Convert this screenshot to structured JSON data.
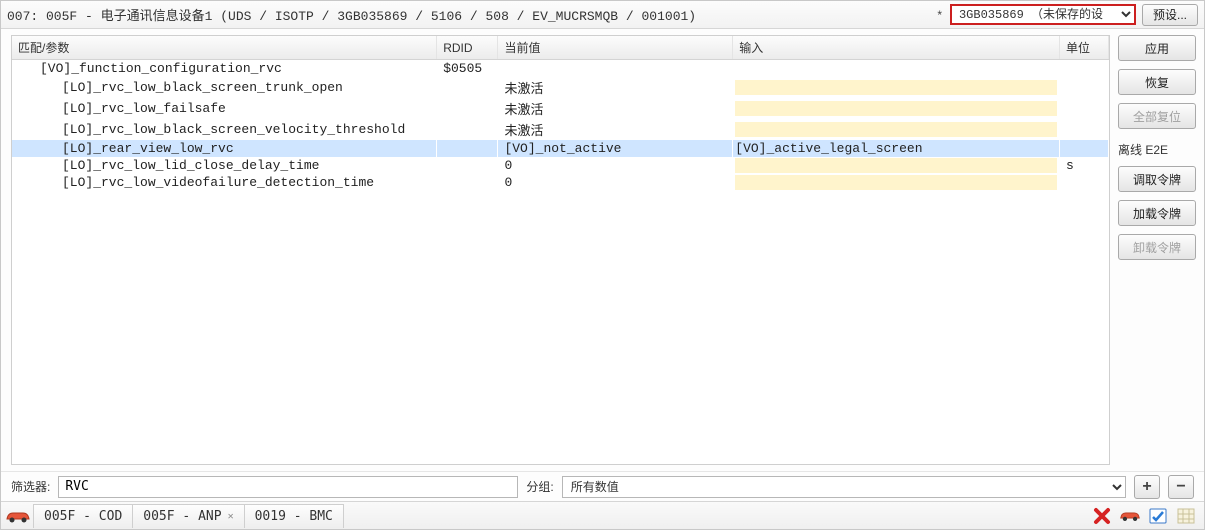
{
  "header": {
    "title": "007: 005F - 电子通讯信息设备1  (UDS / ISOTP / 3GB035869 / 5106 / 508 / EV_MUCRSMQB / 001001)",
    "dirty_marker": "*",
    "preset_selected": "3GB035869 （未保存的设",
    "preset_button": "预设..."
  },
  "table": {
    "headers": {
      "name": "匹配/参数",
      "rdid": "RDID",
      "current": "当前值",
      "input": "输入",
      "unit": "单位"
    },
    "rows": [
      {
        "indent": 1,
        "name": "[VO]_function_configuration_rvc",
        "rdid": "$0505",
        "current": "",
        "input": null,
        "unit": "",
        "selected": false,
        "group": true
      },
      {
        "indent": 2,
        "name": "[LO]_rvc_low_black_screen_trunk_open",
        "rdid": "",
        "current": "未激活",
        "input": "",
        "unit": "",
        "selected": false
      },
      {
        "indent": 2,
        "name": "[LO]_rvc_low_failsafe",
        "rdid": "",
        "current": "未激活",
        "input": "",
        "unit": "",
        "selected": false
      },
      {
        "indent": 2,
        "name": "[LO]_rvc_low_black_screen_velocity_threshold",
        "rdid": "",
        "current": "未激活",
        "input": "",
        "unit": "",
        "selected": false
      },
      {
        "indent": 2,
        "name": "[LO]_rear_view_low_rvc",
        "rdid": "",
        "current": "[VO]_not_active",
        "input": "[VO]_active_legal_screen",
        "unit": "",
        "selected": true
      },
      {
        "indent": 2,
        "name": "[LO]_rvc_low_lid_close_delay_time",
        "rdid": "",
        "current": "0",
        "input": "",
        "unit": "s",
        "selected": false
      },
      {
        "indent": 2,
        "name": "[LO]_rvc_low_videofailure_detection_time",
        "rdid": "",
        "current": "0",
        "input": "",
        "unit": "",
        "selected": false
      }
    ]
  },
  "side": {
    "apply": "应用",
    "restore": "恢复",
    "reset_all": "全部复位",
    "offline_label": "离线 E2E",
    "get_token": "调取令牌",
    "load_token": "加载令牌",
    "unload_token": "卸载令牌"
  },
  "filter": {
    "label": "筛选器:",
    "value": "RVC",
    "group_label": "分组:",
    "group_selected": "所有数值"
  },
  "tabs": [
    {
      "label": "005F - COD",
      "closable": false
    },
    {
      "label": "005F - ANP",
      "closable": true
    },
    {
      "label": "0019 - BMC",
      "closable": false
    }
  ],
  "icons": {
    "car": "car-icon",
    "delete": "delete-x-icon",
    "car2": "car-icon",
    "check": "checklist-icon",
    "grid": "grid-icon"
  }
}
